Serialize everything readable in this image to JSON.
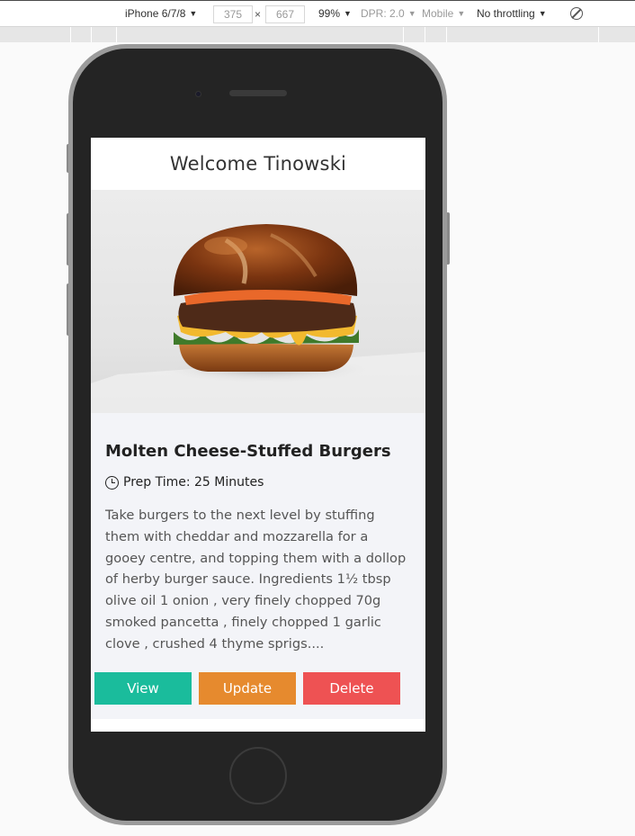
{
  "devtools": {
    "device": "iPhone 6/7/8",
    "width": "375",
    "height_value": "667",
    "times": "×",
    "zoom": "99%",
    "dpr": "DPR: 2.0",
    "mode": "Mobile",
    "throttling": "No throttling",
    "caret": "▼"
  },
  "app": {
    "welcome": "Welcome Tinowski"
  },
  "recipe": {
    "title": "Molten Cheese-Stuffed Burgers",
    "prep_time": "Prep Time: 25 Minutes",
    "description": "Take burgers to the next level by stuffing them with cheddar and mozzarella for a gooey centre, and topping them with a dollop of herby burger sauce. Ingredients 1½ tbsp olive oil 1 onion , very finely chopped 70g smoked pancetta , finely chopped 1 garlic clove , crushed 4 thyme sprigs....",
    "image_icon": "burger-photo"
  },
  "actions": {
    "view_label": "View",
    "update_label": "Update",
    "delete_label": "Delete"
  },
  "colors": {
    "view": "#1abc9c",
    "update": "#e68a2e",
    "delete": "#ee5253"
  }
}
